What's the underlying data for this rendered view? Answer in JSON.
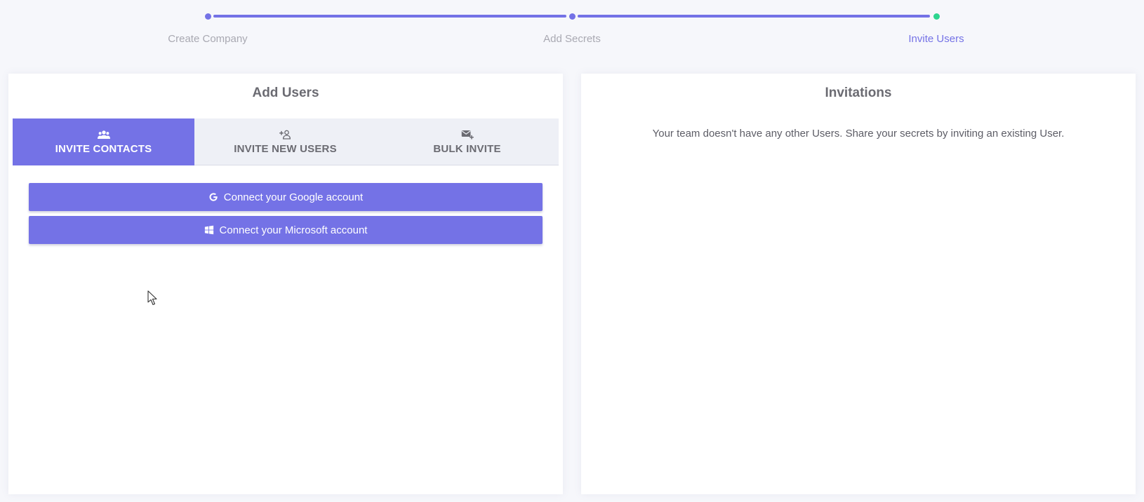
{
  "stepper": {
    "steps": [
      {
        "label": "Create Company",
        "state": "done"
      },
      {
        "label": "Add Secrets",
        "state": "done"
      },
      {
        "label": "Invite Users",
        "state": "current"
      }
    ]
  },
  "add_users": {
    "title": "Add Users",
    "tabs": [
      {
        "label": "INVITE CONTACTS",
        "icon": "users-icon",
        "active": true
      },
      {
        "label": "INVITE NEW USERS",
        "icon": "user-plus-icon",
        "active": false
      },
      {
        "label": "BULK INVITE",
        "icon": "mail-plus-icon",
        "active": false
      }
    ],
    "google_button": "Connect your Google account",
    "microsoft_button": "Connect your Microsoft account"
  },
  "invitations": {
    "title": "Invitations",
    "empty_message": "Your team doesn't have any other Users. Share your secrets by inviting an existing User."
  },
  "colors": {
    "accent": "#7472e6",
    "success": "#2dd58f",
    "muted_text": "#a9a9b2"
  }
}
